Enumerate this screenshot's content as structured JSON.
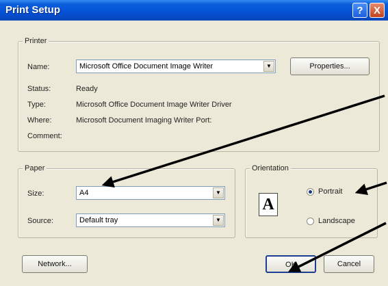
{
  "window": {
    "title": "Print Setup",
    "help_glyph": "?",
    "close_glyph": "X"
  },
  "printer": {
    "legend": "Printer",
    "name_label": "Name:",
    "name_value": "Microsoft Office Document Image Writer",
    "properties_label": "Properties...",
    "status_label": "Status:",
    "status_value": "Ready",
    "type_label": "Type:",
    "type_value": "Microsoft Office Document Image Writer Driver",
    "where_label": "Where:",
    "where_value": "Microsoft Document Imaging Writer Port:",
    "comment_label": "Comment:"
  },
  "paper": {
    "legend": "Paper",
    "size_label": "Size:",
    "size_value": "A4",
    "source_label": "Source:",
    "source_value": "Default tray"
  },
  "orientation": {
    "legend": "Orientation",
    "icon_letter": "A",
    "portrait_label": "Portrait",
    "landscape_label": "Landscape",
    "selected": "portrait"
  },
  "buttons": {
    "network": "Network...",
    "ok": "OK",
    "cancel": "Cancel"
  }
}
